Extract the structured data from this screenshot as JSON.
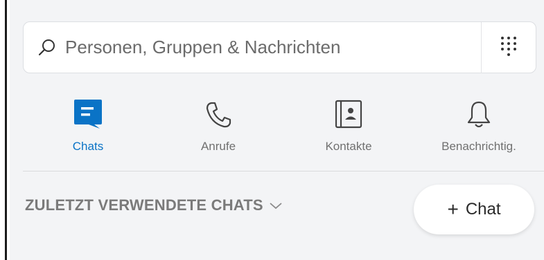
{
  "search": {
    "placeholder": "Personen, Gruppen & Nachrichten",
    "value": ""
  },
  "nav": {
    "items": [
      {
        "label": "Chats",
        "icon": "chat-icon",
        "active": true
      },
      {
        "label": "Anrufe",
        "icon": "phone-icon",
        "active": false
      },
      {
        "label": "Kontakte",
        "icon": "contacts-icon",
        "active": false
      },
      {
        "label": "Benachrichtig.",
        "icon": "bell-icon",
        "active": false
      }
    ]
  },
  "recent": {
    "title": "ZULETZT VERWENDETE CHATS",
    "new_chat_label": "Chat"
  },
  "colors": {
    "accent": "#0a73c6",
    "muted_text": "#707070",
    "background": "#f3f4f6"
  }
}
